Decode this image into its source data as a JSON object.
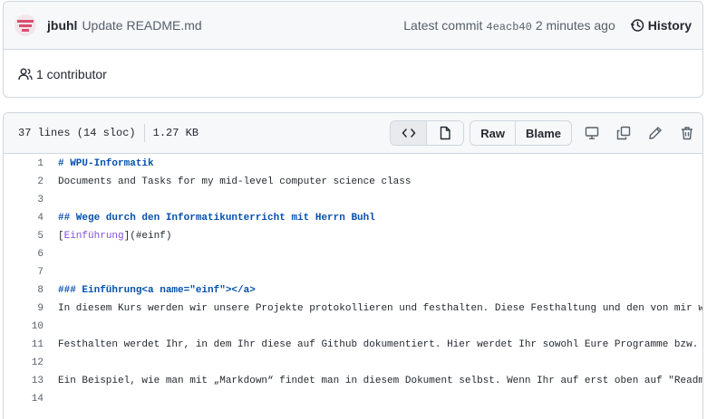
{
  "commit": {
    "author": "jbuhl",
    "message": "Update README.md",
    "latest_label": "Latest commit",
    "sha": "4eacb40",
    "time": "2 minutes ago",
    "history_label": "History"
  },
  "contributors": {
    "label": "1 contributor"
  },
  "file": {
    "lines_info": "37 lines (14 sloc)",
    "size": "1.27 KB",
    "raw_label": "Raw",
    "blame_label": "Blame"
  },
  "code_lines": [
    {
      "num": "1",
      "text": "# WPU-Informatik"
    },
    {
      "num": "2",
      "text": "Documents and Tasks for my mid-level computer science class"
    },
    {
      "num": "3",
      "text": ""
    },
    {
      "num": "4",
      "text": "## Wege durch den Informatikunterricht mit Herrn Buhl"
    },
    {
      "num": "5",
      "text_pre": "[",
      "link": "Einführung",
      "text_post": "](#einf)"
    },
    {
      "num": "6",
      "text": ""
    },
    {
      "num": "7",
      "text": ""
    },
    {
      "num": "8",
      "text": "### Einführung<a name=\"einf\"></a>"
    },
    {
      "num": "9",
      "text": "In diesem Kurs werden wir unsere Projekte protokollieren und festhalten. Diese Festhaltung und den von mir w"
    },
    {
      "num": "10",
      "text": ""
    },
    {
      "num": "11",
      "text": "Festhalten werdet Ihr, in dem Ihr diese auf Github dokumentiert. Hier werdet Ihr sowohl Eure Programme bzw."
    },
    {
      "num": "12",
      "text": ""
    },
    {
      "num": "13",
      "text": "Ein Beispiel, wie man mit „Markdown“ findet man in diesem Dokument selbst. Wenn Ihr auf erst oben auf \"Readm"
    },
    {
      "num": "14",
      "text": ""
    }
  ]
}
